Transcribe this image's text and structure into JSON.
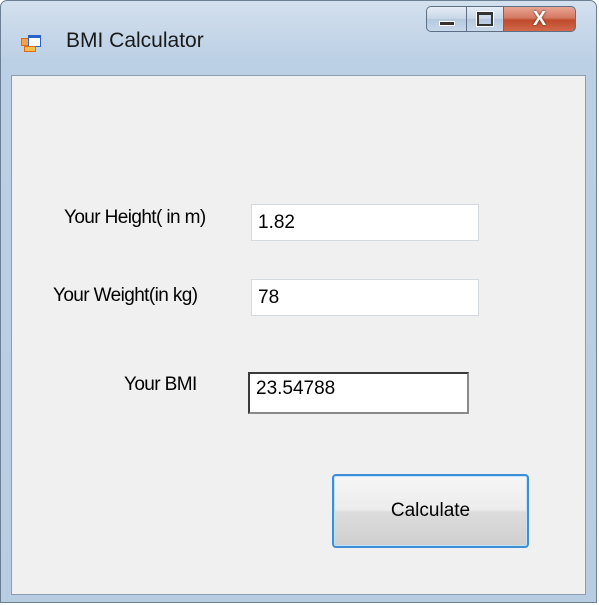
{
  "window": {
    "title": "BMI Calculator",
    "close_glyph": "X"
  },
  "form": {
    "height_label": "Your Height( in m)",
    "height_value": "1.82",
    "weight_label": "Your Weight(in kg)",
    "weight_value": "78",
    "bmi_label": "Your BMI",
    "bmi_value": "23.54788",
    "calculate_label": "Calculate"
  },
  "colors": {
    "client_background": "#f0f0f0",
    "close_button": "#c04a2c",
    "button_focus_border": "#3c8ed6"
  },
  "icons": {
    "app": "form-icon",
    "minimize": "minimize-icon",
    "maximize": "maximize-icon",
    "close": "close-icon"
  }
}
